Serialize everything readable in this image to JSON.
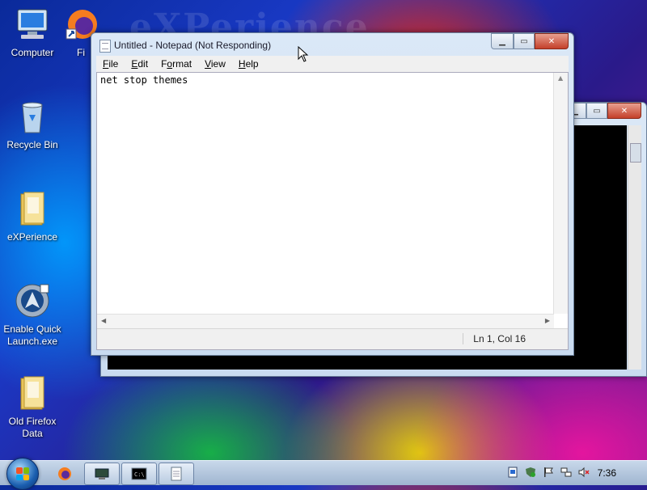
{
  "desktop": {
    "watermark": "eXPerience",
    "icons": [
      {
        "label": "Computer",
        "icon": "computer-icon"
      },
      {
        "label": "Fi",
        "icon": "firefox-shortcut-icon"
      },
      {
        "label": "Recycle Bin",
        "icon": "recycle-bin-icon"
      },
      {
        "label": "eXPerience",
        "icon": "folder-icon"
      },
      {
        "label": "Enable Quick Launch.exe",
        "icon": "quick-launch-icon"
      },
      {
        "label": "Old Firefox Data",
        "icon": "folder-icon"
      }
    ]
  },
  "notepad": {
    "title": "Untitled - Notepad (Not Responding)",
    "menu": [
      {
        "label": "File",
        "accel": "F"
      },
      {
        "label": "Edit",
        "accel": "E"
      },
      {
        "label": "Format",
        "accel": "o"
      },
      {
        "label": "View",
        "accel": "V"
      },
      {
        "label": "Help",
        "accel": "H"
      }
    ],
    "content": "net stop themes",
    "status_position": "Ln 1, Col 16"
  },
  "console": {
    "background": "#000000"
  },
  "taskbar": {
    "items": [
      "start-orb",
      "firefox-icon",
      "network-task-icon",
      "cmd-task-icon",
      "notepad-task-icon"
    ],
    "tray": [
      "tray-doc-icon",
      "tray-shield-icon",
      "tray-flag-icon",
      "tray-network-icon",
      "tray-volume-muted-icon"
    ],
    "clock": "7:36"
  },
  "colors": {
    "close_button": "#c4402a",
    "taskbar": "#9fb5d0"
  }
}
